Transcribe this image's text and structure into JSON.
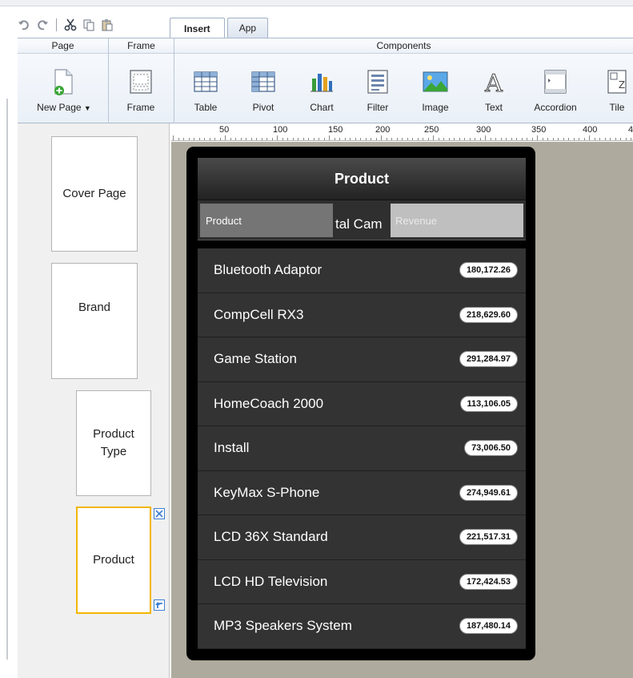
{
  "tabs": [
    {
      "label": "Insert",
      "active": true
    },
    {
      "label": "App",
      "active": false
    }
  ],
  "ribbon": {
    "groups": {
      "page": "Page",
      "frame": "Frame",
      "components": "Components"
    },
    "buttons": {
      "new_page": "New Page",
      "frame": "Frame",
      "table": "Table",
      "pivot": "Pivot",
      "chart": "Chart",
      "filter": "Filter",
      "image": "Image",
      "text": "Text",
      "accordion": "Accordion",
      "tile": "Tile"
    }
  },
  "ruler": [
    "50",
    "100",
    "150",
    "200",
    "250",
    "300",
    "350",
    "400",
    "4"
  ],
  "pages": [
    {
      "label": "Cover Page"
    },
    {
      "label": "Brand"
    },
    {
      "label": "Product\nType"
    },
    {
      "label": "Product",
      "selected": true
    }
  ],
  "widget": {
    "title": "Product",
    "scroll_text": "tal Cam",
    "segments": [
      "Product",
      "Revenue"
    ],
    "rows": [
      {
        "name": "Bluetooth Adaptor",
        "value": "180,172.26"
      },
      {
        "name": "CompCell RX3",
        "value": "218,629.60"
      },
      {
        "name": "Game Station",
        "value": "291,284.97"
      },
      {
        "name": "HomeCoach 2000",
        "value": "113,106.05"
      },
      {
        "name": "Install",
        "value": "73,006.50"
      },
      {
        "name": "KeyMax S-Phone",
        "value": "274,949.61"
      },
      {
        "name": "LCD 36X Standard",
        "value": "221,517.31"
      },
      {
        "name": "LCD HD Television",
        "value": "172,424.53"
      },
      {
        "name": "MP3 Speakers System",
        "value": "187,480.14"
      }
    ]
  },
  "colors": {
    "canvas": "#aeaa9d",
    "selected_page_border": "#f2b600",
    "widget_row": "#333333"
  }
}
